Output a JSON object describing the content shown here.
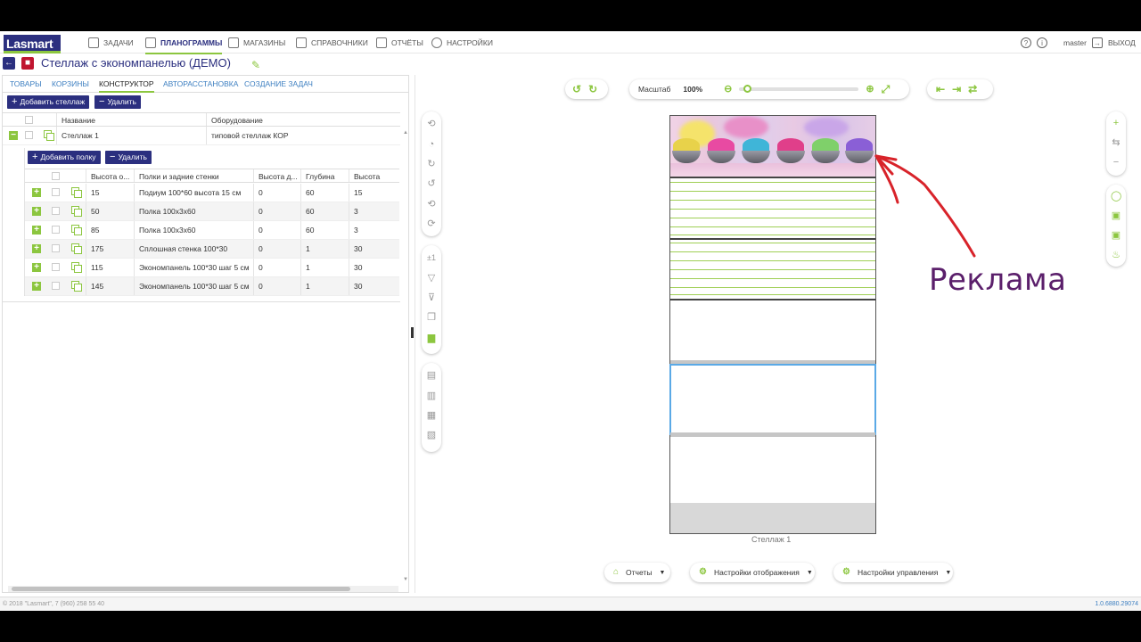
{
  "nav": {
    "logo": "Lasmart",
    "items": [
      {
        "label": "ЗАДАЧИ",
        "active": false
      },
      {
        "label": "ПЛАНОГРАММЫ",
        "active": true
      },
      {
        "label": "МАГАЗИНЫ",
        "active": false
      },
      {
        "label": "СПРАВОЧНИКИ",
        "active": false
      },
      {
        "label": "ОТЧЁТЫ",
        "active": false
      },
      {
        "label": "НАСТРОЙКИ",
        "active": false
      }
    ],
    "user": "master",
    "logout": "ВЫХОД"
  },
  "title": "Стеллаж с экономпанелью (ДЕМО)",
  "tabs": [
    "ТОВАРЫ",
    "КОРЗИНЫ",
    "КОНСТРУКТОР",
    "АВТОРАССТАНОВКА",
    "СОЗДАНИЕ ЗАДАЧ"
  ],
  "rack_toolbar": {
    "add": "Добавить стеллаж",
    "delete": "Удалить"
  },
  "rack_grid": {
    "columns": [
      "Название",
      "Оборудование"
    ],
    "rows": [
      {
        "name": "Стеллаж 1",
        "equipment": "типовой стеллаж КОР"
      }
    ]
  },
  "shelf_toolbar": {
    "add": "Добавить полку",
    "delete": "Удалить"
  },
  "shelf_grid": {
    "columns": [
      "Высота о...",
      "Полки и задние стенки",
      "Высота д...",
      "Глубина",
      "Высота"
    ],
    "rows": [
      [
        "15",
        "Подиум 100*60 высота 15 см",
        "0",
        "60",
        "15"
      ],
      [
        "50",
        "Полка 100х3х60",
        "0",
        "60",
        "3"
      ],
      [
        "85",
        "Полка 100х3х60",
        "0",
        "60",
        "3"
      ],
      [
        "175",
        "Сплошная стенка 100*30",
        "0",
        "1",
        "30"
      ],
      [
        "115",
        "Экономпанель 100*30 шаг 5 см",
        "0",
        "1",
        "30"
      ],
      [
        "145",
        "Экономпанель 100*30 шаг 5 см",
        "0",
        "1",
        "30"
      ]
    ]
  },
  "canvas": {
    "zoom_label": "Масштаб",
    "zoom_value": "100%",
    "zoom_level": 0.04,
    "rack_label": "Стеллаж 1",
    "bottom_buttons": [
      "Отчеты",
      "Настройки отображения",
      "Настройки управления"
    ]
  },
  "annotation": "Реклама",
  "footer": {
    "copyright": "© 2018 \"Lasmart\", 7 (960) 258 55 40",
    "version": "1.0.6880.29074"
  },
  "colors": {
    "brand": "#2b2f7f",
    "accent": "#8cc63f",
    "selection": "#5aa9e6",
    "annotation": "#5b1f6b",
    "arrow": "#d8232a"
  }
}
